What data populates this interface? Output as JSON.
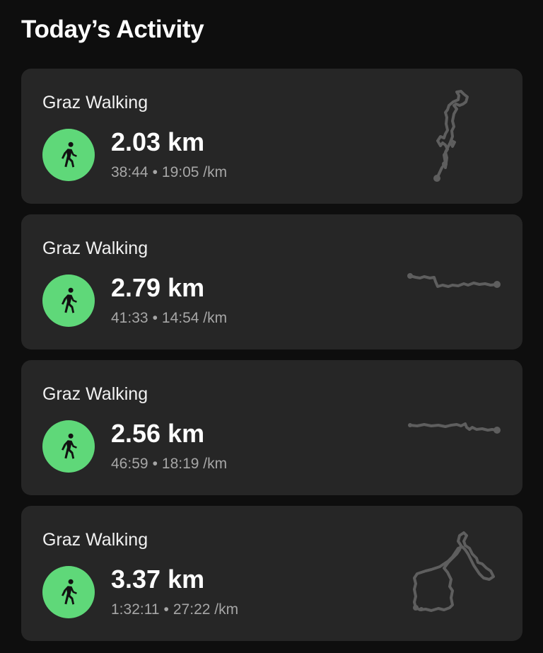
{
  "header": {
    "title": "Today’s Activity"
  },
  "activities": [
    {
      "name": "Graz Walking",
      "distance": "2.03 km",
      "duration": "38:44",
      "pace": "19:05 /km",
      "icon": "walking-person-icon"
    },
    {
      "name": "Graz Walking",
      "distance": "2.79 km",
      "duration": "41:33",
      "pace": "14:54 /km",
      "icon": "walking-person-icon"
    },
    {
      "name": "Graz Walking",
      "distance": "2.56 km",
      "duration": "46:59",
      "pace": "18:19 /km",
      "icon": "walking-person-icon"
    },
    {
      "name": "Graz Walking",
      "distance": "3.37 km",
      "duration": "1:32:11",
      "pace": "27:22 /km",
      "icon": "walking-person-icon"
    }
  ],
  "separator": "•",
  "colors": {
    "background": "#0e0e0e",
    "card": "#262626",
    "badge": "#5fd879",
    "route": "#5e5e5e",
    "secondary_text": "#a6a6a6"
  }
}
